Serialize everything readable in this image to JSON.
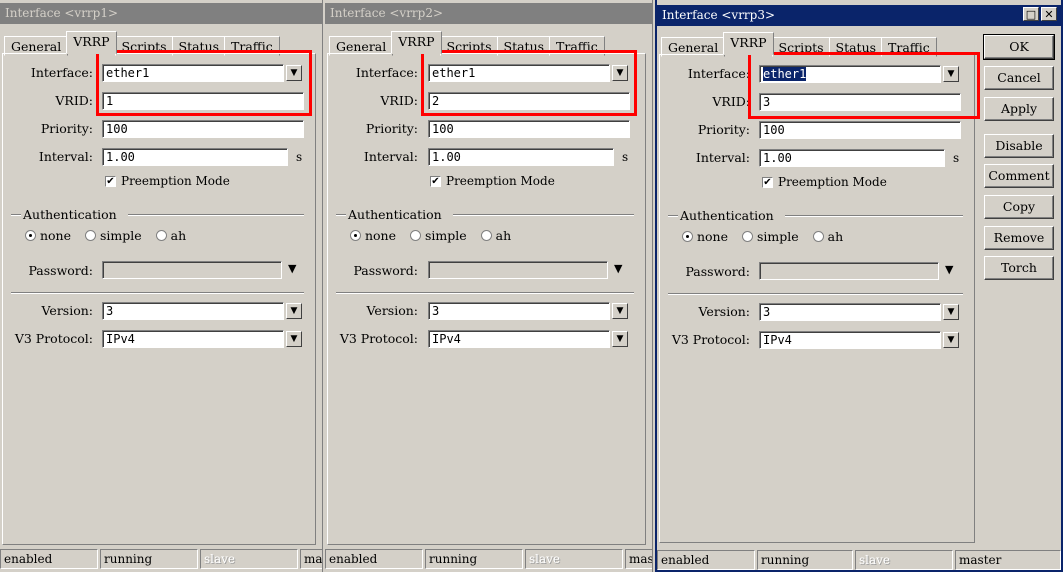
{
  "windows": [
    {
      "title": "Interface <vrrp1>",
      "tabs": [
        "General",
        "VRRP",
        "Scripts",
        "Status",
        "Traffic"
      ],
      "active_tab": "VRRP",
      "fields": {
        "interface": {
          "label": "Interface:",
          "value": "ether1"
        },
        "vrid": {
          "label": "VRID:",
          "value": "1"
        },
        "priority": {
          "label": "Priority:",
          "value": "100"
        },
        "interval": {
          "label": "Interval:",
          "value": "1.00",
          "unit": "s"
        },
        "preemption": {
          "label": "Preemption Mode",
          "checked": true
        },
        "authentication": {
          "title": "Authentication",
          "options": [
            "none",
            "simple",
            "ah"
          ],
          "selected": "none"
        },
        "password": {
          "label": "Password:",
          "value": ""
        },
        "version": {
          "label": "Version:",
          "value": "3"
        },
        "v3protocol": {
          "label": "V3 Protocol:",
          "value": "IPv4"
        }
      },
      "status": [
        "enabled",
        "running",
        "slave",
        "mas"
      ]
    },
    {
      "title": "Interface <vrrp2>",
      "tabs": [
        "General",
        "VRRP",
        "Scripts",
        "Status",
        "Traffic"
      ],
      "active_tab": "VRRP",
      "fields": {
        "interface": {
          "label": "Interface:",
          "value": "ether1"
        },
        "vrid": {
          "label": "VRID:",
          "value": "2"
        },
        "priority": {
          "label": "Priority:",
          "value": "100"
        },
        "interval": {
          "label": "Interval:",
          "value": "1.00",
          "unit": "s"
        },
        "preemption": {
          "label": "Preemption Mode",
          "checked": true
        },
        "authentication": {
          "title": "Authentication",
          "options": [
            "none",
            "simple",
            "ah"
          ],
          "selected": "none"
        },
        "password": {
          "label": "Password:",
          "value": ""
        },
        "version": {
          "label": "Version:",
          "value": "3"
        },
        "v3protocol": {
          "label": "V3 Protocol:",
          "value": "IPv4"
        }
      },
      "status": [
        "enabled",
        "running",
        "slave",
        "mas"
      ]
    },
    {
      "title": "Interface <vrrp3>",
      "tabs": [
        "General",
        "VRRP",
        "Scripts",
        "Status",
        "Traffic"
      ],
      "active_tab": "VRRP",
      "fields": {
        "interface": {
          "label": "Interface:",
          "value": "ether1"
        },
        "vrid": {
          "label": "VRID:",
          "value": "3"
        },
        "priority": {
          "label": "Priority:",
          "value": "100"
        },
        "interval": {
          "label": "Interval:",
          "value": "1.00",
          "unit": "s"
        },
        "preemption": {
          "label": "Preemption Mode",
          "checked": true
        },
        "authentication": {
          "title": "Authentication",
          "options": [
            "none",
            "simple",
            "ah"
          ],
          "selected": "none"
        },
        "password": {
          "label": "Password:",
          "value": ""
        },
        "version": {
          "label": "Version:",
          "value": "3"
        },
        "v3protocol": {
          "label": "V3 Protocol:",
          "value": "IPv4"
        }
      },
      "status": [
        "enabled",
        "running",
        "slave",
        "master"
      ]
    }
  ],
  "side_buttons": [
    "OK",
    "Cancel",
    "Apply",
    "Disable",
    "Comment",
    "Copy",
    "Remove",
    "Torch"
  ],
  "titlebar_buttons": {
    "restore": "□",
    "close": "✕"
  },
  "dropdown_glyph": "▼",
  "checkmark_glyph": "✔",
  "colors": {
    "highlight": "#ff0000",
    "active_title": "#0a246a",
    "inactive_title": "#808080",
    "face": "#d4d0c8"
  }
}
